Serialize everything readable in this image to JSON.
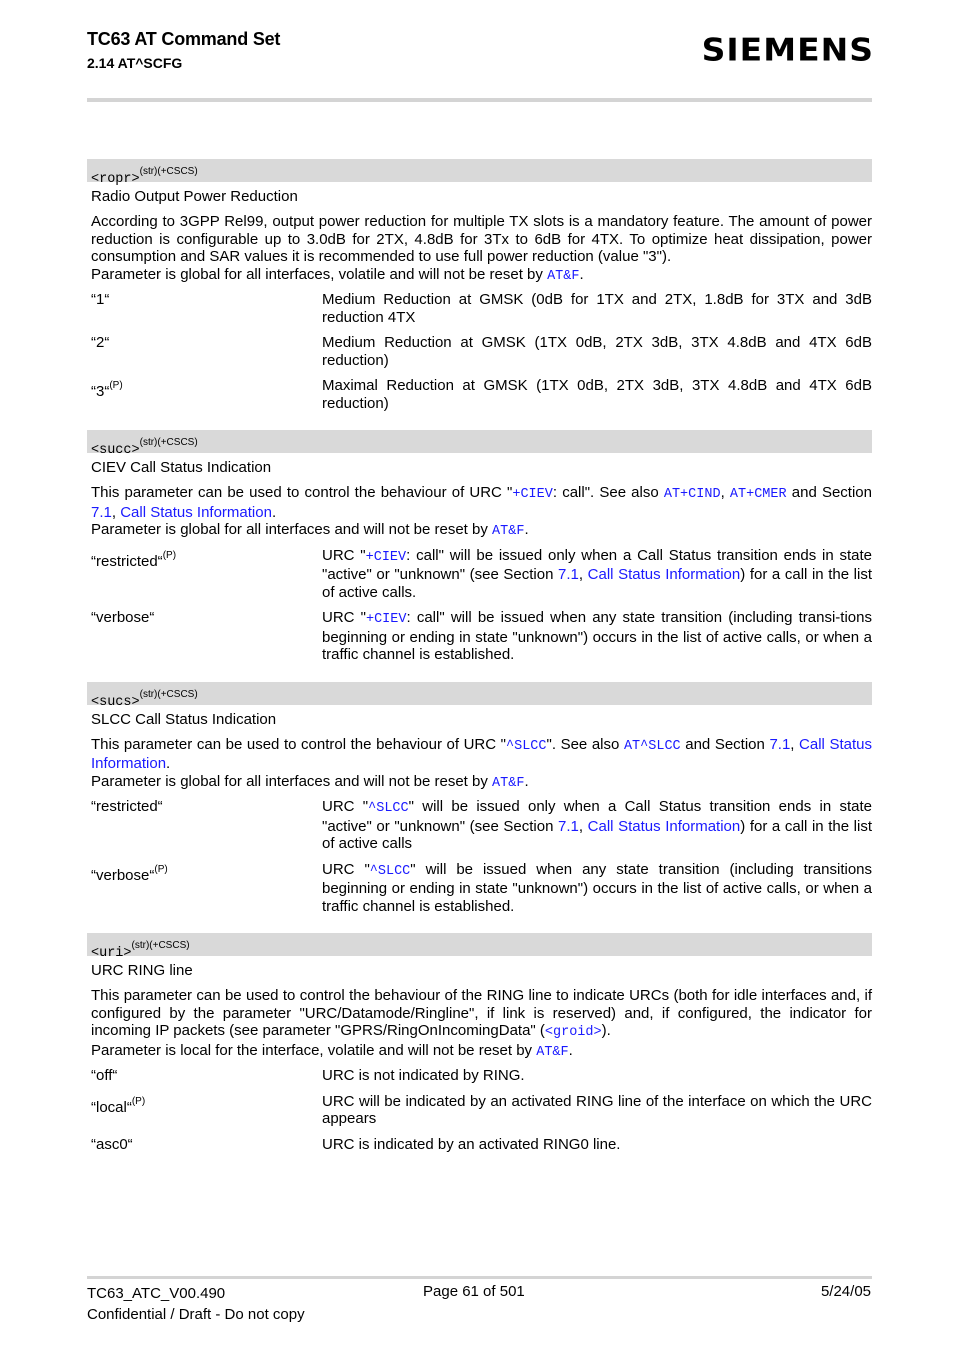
{
  "header": {
    "title": "TC63 AT Command Set",
    "subtitle": "2.14 AT^SCFG",
    "logo": "SIEMENS"
  },
  "sections": [
    {
      "param": "<ropr>",
      "attrs": "(str)(+CSCS)",
      "title": "Radio Output Power Reduction",
      "desc_parts": [
        {
          "t": "According to 3GPP Rel99, output power reduction for multiple TX slots is a mandatory feature. The amount of power reduction is configurable up to 3.0dB for 2TX, 4.8dB for 3Tx to 6dB for 4TX. To optimize heat dissipation, power consumption and SAR values it is recommended to use full power reduction (value \"3\")."
        },
        {
          "br": true
        },
        {
          "t": "Parameter is global for all interfaces, volatile and will not be reset by "
        },
        {
          "t": "AT&F",
          "link": true,
          "mono": true
        },
        {
          "t": "."
        }
      ],
      "values": [
        {
          "key": "“1“",
          "sup": "",
          "desc_parts": [
            {
              "t": "Medium Reduction at GMSK (0dB for 1TX and 2TX, 1.8dB for 3TX and 3dB reduction 4TX"
            }
          ]
        },
        {
          "key": "“2“",
          "sup": "",
          "desc_parts": [
            {
              "t": "Medium Reduction at GMSK (1TX 0dB, 2TX 3dB, 3TX 4.8dB and 4TX 6dB reduction)"
            }
          ]
        },
        {
          "key": "“3“",
          "sup": "(P)",
          "desc_parts": [
            {
              "t": "Maximal Reduction at GMSK (1TX 0dB, 2TX 3dB, 3TX 4.8dB and 4TX 6dB reduction)"
            }
          ]
        }
      ]
    },
    {
      "param": "<succ>",
      "attrs": "(str)(+CSCS)",
      "title": "CIEV Call Status Indication",
      "desc_parts": [
        {
          "t": "This parameter can be used to control the behaviour of URC \""
        },
        {
          "t": "+CIEV",
          "link": true,
          "mono": true
        },
        {
          "t": ": call\". See also "
        },
        {
          "t": "AT+CIND",
          "link": true,
          "mono": true
        },
        {
          "t": ", "
        },
        {
          "t": "AT+CMER",
          "link": true,
          "mono": true
        },
        {
          "t": " and Section "
        },
        {
          "t": "7.1",
          "link": true
        },
        {
          "t": ", "
        },
        {
          "t": "Call Status Information",
          "link": true
        },
        {
          "t": "."
        },
        {
          "br": true
        },
        {
          "t": "Parameter is global for all interfaces and will not be reset by "
        },
        {
          "t": "AT&F",
          "link": true,
          "mono": true
        },
        {
          "t": "."
        }
      ],
      "values": [
        {
          "key": "“restricted“",
          "sup": "(P)",
          "desc_parts": [
            {
              "t": "URC \""
            },
            {
              "t": "+CIEV",
              "link": true,
              "mono": true
            },
            {
              "t": ": call\" will be issued only when a Call Status transition ends in state \"active\" or \"unknown\" (see Section "
            },
            {
              "t": "7.1",
              "link": true
            },
            {
              "t": ", "
            },
            {
              "t": "Call Status Information",
              "link": true
            },
            {
              "t": ") for a call in the list of active calls."
            }
          ]
        },
        {
          "key": "“verbose“",
          "sup": "",
          "desc_parts": [
            {
              "t": "URC \""
            },
            {
              "t": "+CIEV",
              "link": true,
              "mono": true
            },
            {
              "t": ": call\" will be issued when any state transition (including transi-tions beginning or ending in state \"unknown\") occurs in the list of active calls, or when a traffic channel is established."
            }
          ]
        }
      ]
    },
    {
      "param": "<sucs>",
      "attrs": "(str)(+CSCS)",
      "title": "SLCC Call Status Indication",
      "desc_parts": [
        {
          "t": "This parameter can be used to control the behaviour of URC \""
        },
        {
          "t": "^SLCC",
          "link": true,
          "mono": true
        },
        {
          "t": "\". See also "
        },
        {
          "t": "AT^SLCC",
          "link": true,
          "mono": true
        },
        {
          "t": " and Section "
        },
        {
          "t": "7.1",
          "link": true
        },
        {
          "t": ", "
        },
        {
          "t": "Call Status Information",
          "link": true
        },
        {
          "t": "."
        },
        {
          "br": true
        },
        {
          "t": "Parameter is global for all interfaces and will not be reset by "
        },
        {
          "t": "AT&F",
          "link": true,
          "mono": true
        },
        {
          "t": "."
        }
      ],
      "values": [
        {
          "key": "“restricted“",
          "sup": "",
          "desc_parts": [
            {
              "t": "URC \""
            },
            {
              "t": "^SLCC",
              "link": true,
              "mono": true
            },
            {
              "t": "\" will be issued only when a Call Status transition ends in state \"active\" or \"unknown\" (see Section "
            },
            {
              "t": "7.1",
              "link": true
            },
            {
              "t": ", "
            },
            {
              "t": "Call Status Information",
              "link": true
            },
            {
              "t": ") for a call in the list of active calls"
            }
          ]
        },
        {
          "key": "“verbose“",
          "sup": "(P)",
          "desc_parts": [
            {
              "t": "URC \""
            },
            {
              "t": "^SLCC",
              "link": true,
              "mono": true
            },
            {
              "t": "\" will be issued when any state transition (including transitions beginning or ending in state \"unknown\") occurs in the list of active calls, or when a traffic channel is established."
            }
          ]
        }
      ]
    },
    {
      "param": "<uri>",
      "attrs": "(str)(+CSCS)",
      "title": "URC RING line",
      "desc_parts": [
        {
          "t": "This parameter can be used to control the behaviour of the RING line to indicate URCs (both for idle interfaces and, if configured by the parameter \"URC/Datamode/Ringline\", if link is reserved) and, if configured, the indicator for incoming IP packets (see parameter \"GPRS/RingOnIncomingData\" ("
        },
        {
          "t": "<groid>",
          "link": true,
          "mono": true
        },
        {
          "t": ")."
        },
        {
          "br": true
        },
        {
          "t": "Parameter is local for the interface, volatile and will not be reset by "
        },
        {
          "t": "AT&F",
          "link": true,
          "mono": true
        },
        {
          "t": "."
        }
      ],
      "values": [
        {
          "key": "“off“",
          "sup": "",
          "desc_parts": [
            {
              "t": "URC is not indicated by RING."
            }
          ]
        },
        {
          "key": "“local“",
          "sup": "(P)",
          "desc_parts": [
            {
              "t": "URC will be indicated by an activated RING line of the interface on which the URC appears"
            }
          ]
        },
        {
          "key": "“asc0“",
          "sup": "",
          "desc_parts": [
            {
              "t": "URC is indicated by an activated RING0 line."
            }
          ]
        }
      ]
    }
  ],
  "footer": {
    "doc_id": "TC63_ATC_V00.490",
    "confidential": "Confidential / Draft - Do not copy",
    "page": "Page 61 of 501",
    "date": "5/24/05"
  },
  "colors": {
    "link": "#1a1aff",
    "param_header_bg": "#d9d9d9",
    "rule": "#d4d4d4"
  }
}
